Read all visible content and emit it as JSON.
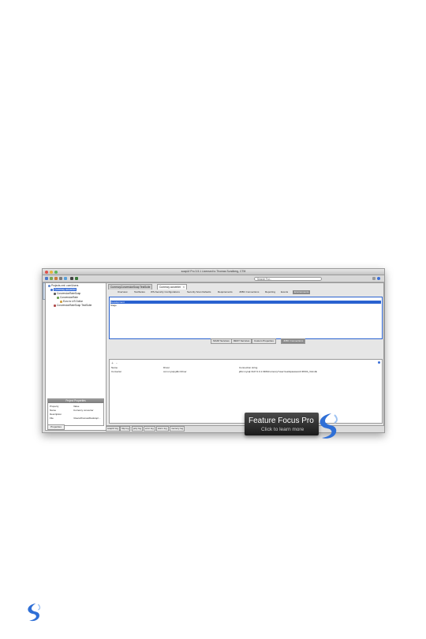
{
  "app": {
    "window_title": "soapUI Pro 3.5.1 Licensed to Thomas Sundberg, CTM",
    "search_placeholder": "Search For..."
  },
  "navigator": {
    "tab_label": "Navigator",
    "tree": [
      "Projects.xml: com/Users",
      "Currency converter",
      "ConversionRateSoap",
      "ConversionRate",
      "Euro to US Dollar",
      "ConversionRateSoap TestSuite"
    ]
  },
  "properties": {
    "title": "Project Properties",
    "columns": [
      "Property",
      "Value"
    ],
    "rows": [
      {
        "name": "Name",
        "value": "Currency converter"
      },
      {
        "name": "Description",
        "value": ""
      },
      {
        "name": "File",
        "value": "/Users/thomas/Desktop/..."
      }
    ],
    "tab_label": "Properties"
  },
  "editor": {
    "doc_tabs": [
      {
        "label": "CurrencyConversionSoap TestSuite"
      },
      {
        "label": "Currency converter"
      }
    ],
    "sub_tabs": [
      "Overview",
      "TestSuites",
      "WS-Security Configurations",
      "Security Scan Defaults",
      "Requirements",
      "JDBC Connections",
      "Reporting",
      "Events",
      "Environments"
    ],
    "active_sub_tab": "Environments",
    "list_rows": [
      "Development",
      "Stage"
    ],
    "bottom_tabs": [
      "SOAP Services",
      "REST Services",
      "Custom Properties",
      "JDBC Connections"
    ],
    "active_bottom_tab": "JDBC Connections",
    "table": {
      "headers": [
        "Name",
        "Driver",
        "Connection string"
      ],
      "rows": [
        {
          "name": "Converter",
          "driver": "com.mysql.jdbc.Driver",
          "conn": "jdbc:mysql://127.0.0.1:3306/currency?user=test&password=PASS_VALUE"
        }
      ]
    }
  },
  "log_tabs": [
    "soapUI log",
    "http log",
    "jetty log",
    "error log",
    "wsrm log",
    "memory log"
  ],
  "promo": {
    "title": "Feature Focus Pro",
    "subtitle": "Click to learn more"
  },
  "colors": {
    "selection_blue": "#2a62d0",
    "promo_bg": "#2a2a2a",
    "logo_blue": "#2f6fd6"
  }
}
